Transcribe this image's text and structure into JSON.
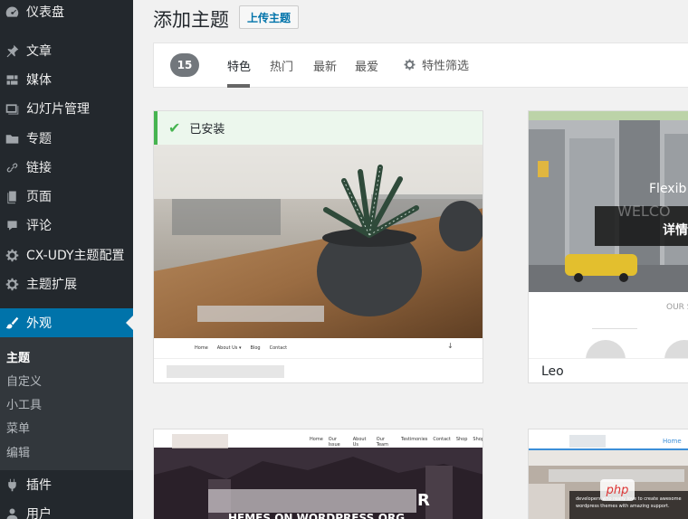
{
  "sidebar": {
    "items": [
      {
        "label": "仪表盘",
        "icon": "dashboard-icon"
      },
      {
        "label": "文章",
        "icon": "pin-icon"
      },
      {
        "label": "媒体",
        "icon": "media-icon"
      },
      {
        "label": "幻灯片管理",
        "icon": "slides-icon"
      },
      {
        "label": "专题",
        "icon": "folder-icon"
      },
      {
        "label": "链接",
        "icon": "link-icon"
      },
      {
        "label": "页面",
        "icon": "page-icon"
      },
      {
        "label": "评论",
        "icon": "comment-icon"
      },
      {
        "label": "CX-UDY主题配置",
        "icon": "gear-icon"
      },
      {
        "label": "主题扩展",
        "icon": "gear-icon"
      },
      {
        "label": "外观",
        "icon": "brush-icon"
      },
      {
        "label": "插件",
        "icon": "plugin-icon"
      },
      {
        "label": "用户",
        "icon": "user-icon"
      }
    ],
    "submenu": [
      "主题",
      "自定义",
      "小工具",
      "菜单",
      "编辑"
    ]
  },
  "header": {
    "title": "添加主题",
    "upload_label": "上传主题"
  },
  "filter": {
    "count": "15",
    "tabs": [
      "特色",
      "热门",
      "最新",
      "最爱"
    ],
    "feature_filter": "特性筛选"
  },
  "themes": {
    "card1": {
      "notice": "已安装",
      "nav": [
        "Home",
        "About Us ▾",
        "Blog",
        "Contact"
      ]
    },
    "card2": {
      "name": "Leo",
      "hero_text": "Flexib",
      "welcome": "WELCO",
      "details": "详情",
      "section": "OUR S"
    },
    "card3": {
      "nav": [
        "Home",
        "Our Issue",
        "About Us",
        "Our Team",
        "Testimonies",
        "Contact",
        "Shop",
        "Shop"
      ],
      "hero_tail": "R",
      "subtitle": "HEMES ON WORDPRESS.ORG"
    },
    "card4": {
      "nav": "Home",
      "line1": "developers who really love to create awesome",
      "line2": "wordpress themes with amazing support."
    }
  },
  "watermark": "php",
  "colors": {
    "sidebar_bg": "#23282d",
    "active_bg": "#0073aa",
    "installed_green": "#46b450"
  }
}
